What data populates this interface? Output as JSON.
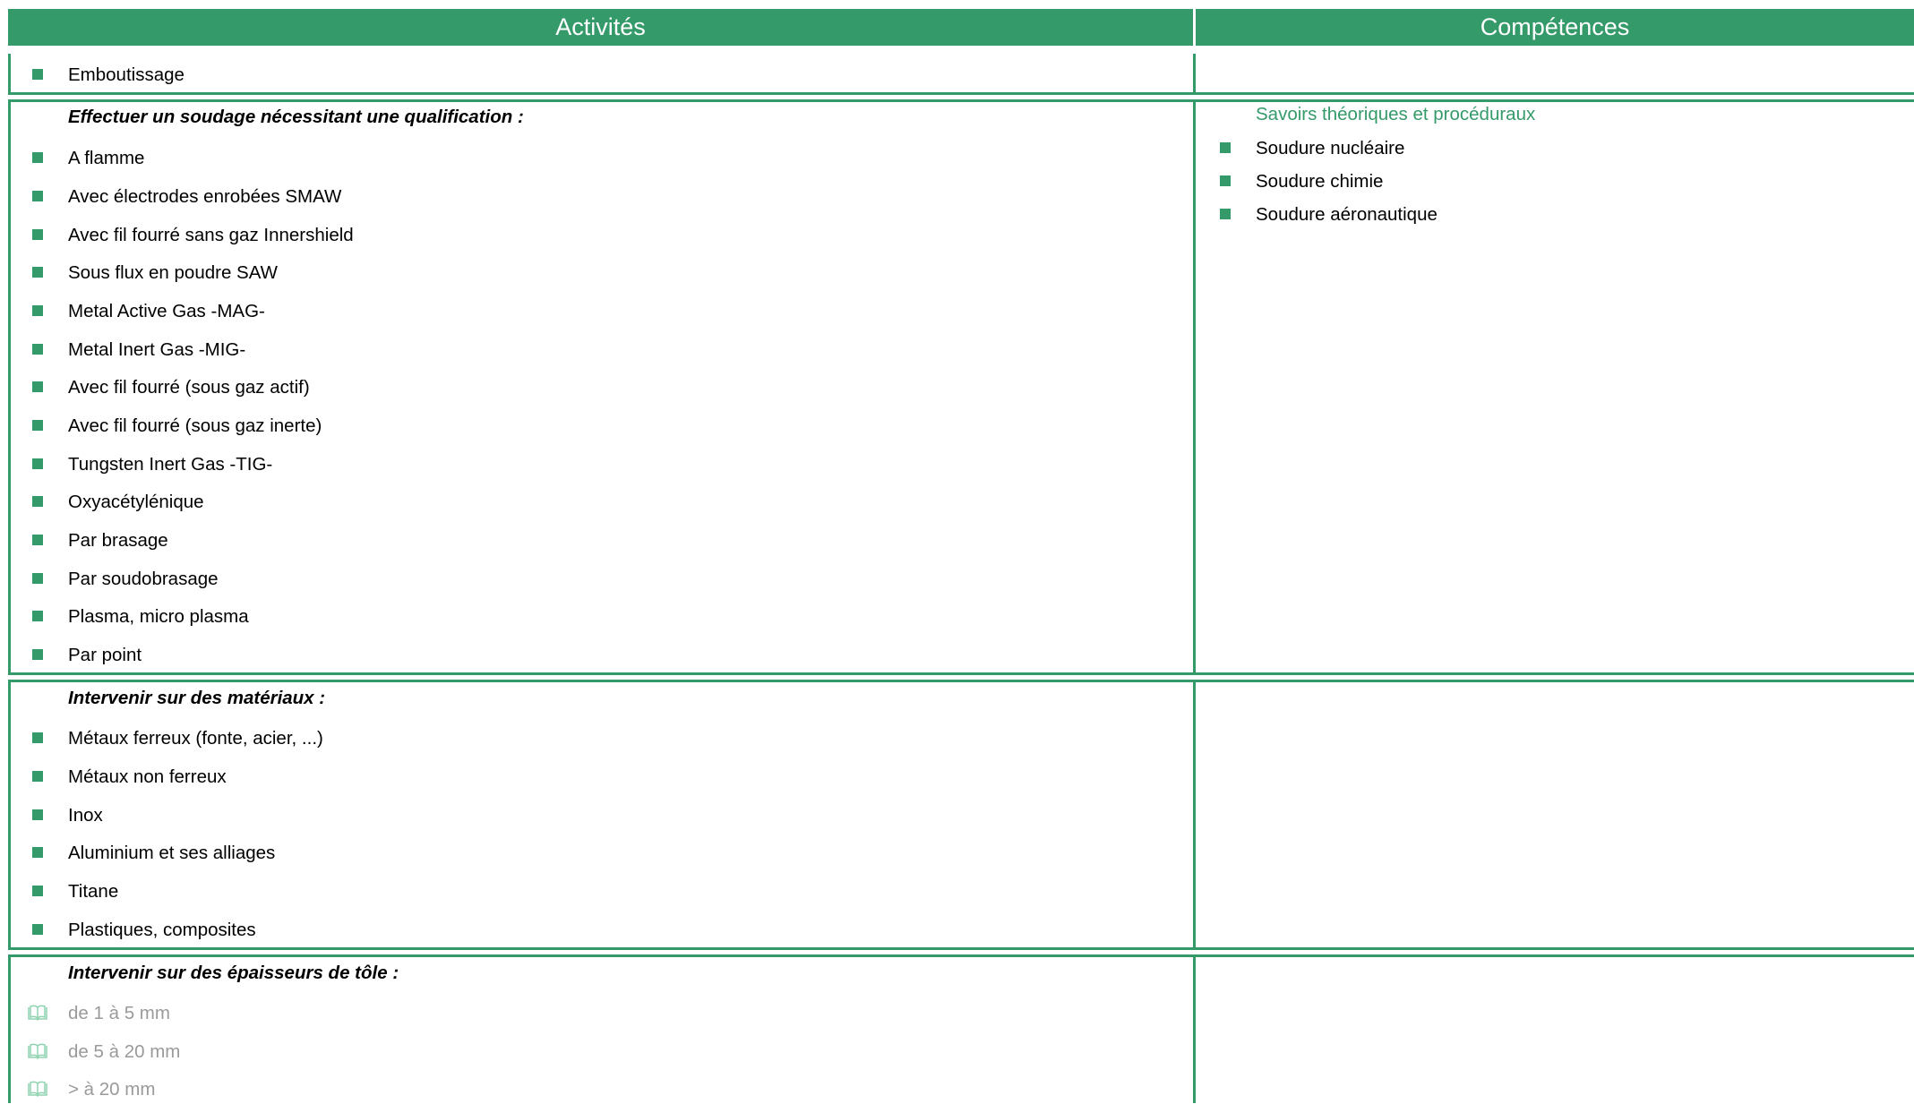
{
  "header": {
    "left": "Activités",
    "right": "Compétences"
  },
  "section1": {
    "items": [
      "Emboutissage"
    ]
  },
  "section2": {
    "heading": "Effectuer un soudage nécessitant une qualification :",
    "items": [
      "A flamme",
      "Avec électrodes enrobées SMAW",
      "Avec fil fourré sans gaz Innershield",
      "Sous flux en poudre SAW",
      "Metal Active Gas -MAG-",
      "Metal Inert Gas -MIG-",
      "Avec fil fourré (sous gaz actif)",
      "Avec fil fourré (sous gaz inerte)",
      "Tungsten Inert Gas -TIG-",
      "Oxyacétylénique",
      "Par brasage",
      "Par soudobrasage",
      "Plasma, micro plasma",
      "Par point"
    ],
    "competences_heading": "Savoirs théoriques et procéduraux",
    "competences": [
      "Soudure nucléaire",
      "Soudure chimie",
      "Soudure aéronautique"
    ]
  },
  "section3": {
    "heading": "Intervenir sur des matériaux :",
    "items": [
      "Métaux ferreux (fonte, acier, ...)",
      "Métaux non ferreux",
      "Inox",
      "Aluminium et ses alliages",
      "Titane",
      "Plastiques, composites"
    ]
  },
  "section4": {
    "heading": "Intervenir sur des épaisseurs de tôle :",
    "items": [
      "de 1 à 5 mm",
      "de 5 à 20 mm",
      "> à 20 mm"
    ]
  },
  "colors": {
    "accent": "#359a6a",
    "muted_text": "#9a9a9a"
  }
}
